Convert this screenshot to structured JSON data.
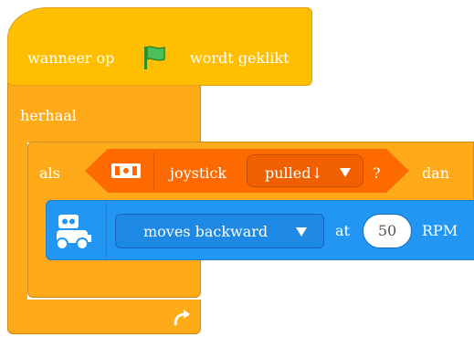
{
  "hat_block": {
    "text_before": "wanneer op",
    "flag_icon": "green-flag-icon",
    "text_after": "wordt geklikt",
    "color": "#FFBF00"
  },
  "repeat_block": {
    "label": "herhaal",
    "loop_icon": "loop-arrow-icon",
    "color": "#FFAB19"
  },
  "if_block": {
    "if_label": "als",
    "then_label": "dan",
    "condition": {
      "sensor_icon": "joystick-sensor-icon",
      "label": "joystick",
      "dropdown_value": "pulled↓",
      "question": "?",
      "color": "#FF6A00"
    }
  },
  "motor_block": {
    "icon": "robot-motor-icon",
    "direction_value": "moves backward",
    "at_label": "at",
    "speed_value": "50",
    "unit_label": "RPM",
    "color": "#2196F3"
  }
}
